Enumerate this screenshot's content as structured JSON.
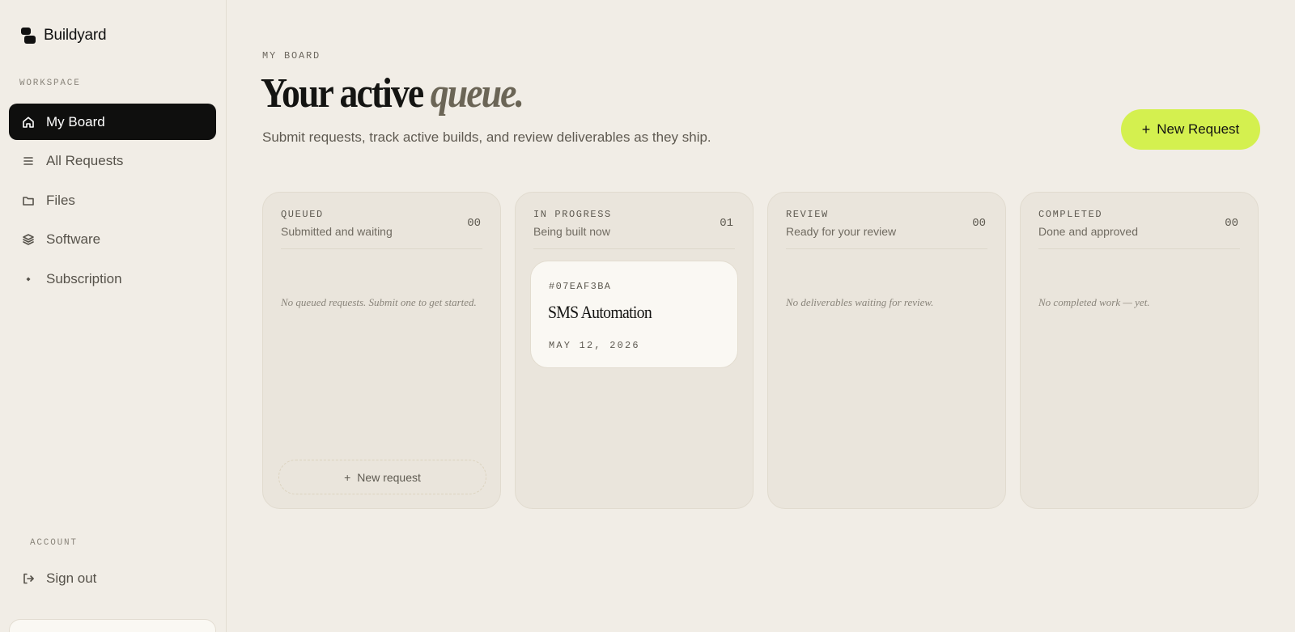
{
  "brand": {
    "name": "Buildyard"
  },
  "sidebar": {
    "workspace_label": "WORKSPACE",
    "items": [
      {
        "label": "My Board",
        "icon": "home-icon",
        "active": true
      },
      {
        "label": "All Requests",
        "icon": "list-icon",
        "active": false
      },
      {
        "label": "Files",
        "icon": "folder-icon",
        "active": false
      },
      {
        "label": "Software",
        "icon": "layers-icon",
        "active": false
      },
      {
        "label": "Subscription",
        "icon": "diamond-icon",
        "active": false
      }
    ],
    "account_label": "ACCOUNT",
    "sign_out": "Sign out"
  },
  "header": {
    "eyebrow": "MY BOARD",
    "title_plain": "Your active",
    "title_italic": "queue.",
    "subtitle": "Submit requests, track active builds, and review deliverables as they ship.",
    "new_request": "New Request"
  },
  "board": {
    "columns": [
      {
        "title": "QUEUED",
        "subtitle": "Submitted and waiting",
        "count": "00",
        "empty": "No queued requests. Submit one to get started.",
        "add_label": "New request"
      },
      {
        "title": "IN PROGRESS",
        "subtitle": "Being built now",
        "count": "01",
        "cards": [
          {
            "id": "#07EAF3BA",
            "title": "SMS Automation",
            "date": "MAY 12, 2026"
          }
        ]
      },
      {
        "title": "REVIEW",
        "subtitle": "Ready for your review",
        "count": "00",
        "empty": "No deliverables waiting for review."
      },
      {
        "title": "COMPLETED",
        "subtitle": "Done and approved",
        "count": "00",
        "empty": "No completed work — yet."
      }
    ]
  },
  "colors": {
    "accent": "#d4f04f",
    "background": "#f1ede6",
    "active_nav": "#0f0f0e"
  }
}
